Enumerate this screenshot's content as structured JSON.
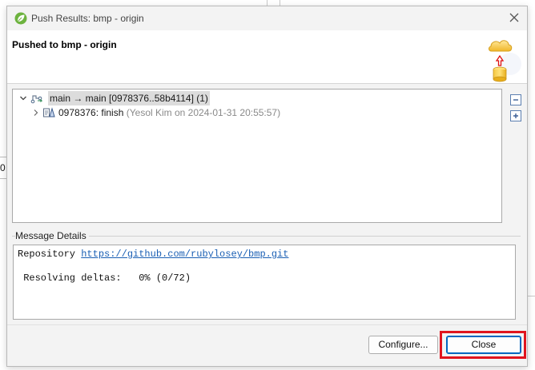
{
  "window": {
    "title": "Push Results: bmp - origin",
    "header_title": "Pushed to bmp - origin"
  },
  "tree": {
    "branch_row": {
      "label": "main → main [0978376..58b4114] (1)",
      "expanded": true,
      "icon": "branch-icon"
    },
    "commit_row": {
      "id_message": "0978376: finish",
      "meta": "(Yesol Kim on 2024-01-31 20:55:57)",
      "expanded": false,
      "icon": "commit-icon"
    }
  },
  "side_buttons": {
    "collapse_icon": "collapse-all-icon",
    "expand_icon": "expand-all-icon"
  },
  "message_details": {
    "label": "Message Details",
    "repository_label": "Repository",
    "repository_url": "https://github.com/rubylosey/bmp.git",
    "progress_line": " Resolving deltas:   0% (0/72)"
  },
  "buttons": {
    "configure": "Configure...",
    "close": "Close"
  },
  "background": {
    "fragment_text": "0"
  },
  "colors": {
    "highlight": "#e0141e",
    "link": "#1a5fb4",
    "selection": "#dcdcdc"
  }
}
